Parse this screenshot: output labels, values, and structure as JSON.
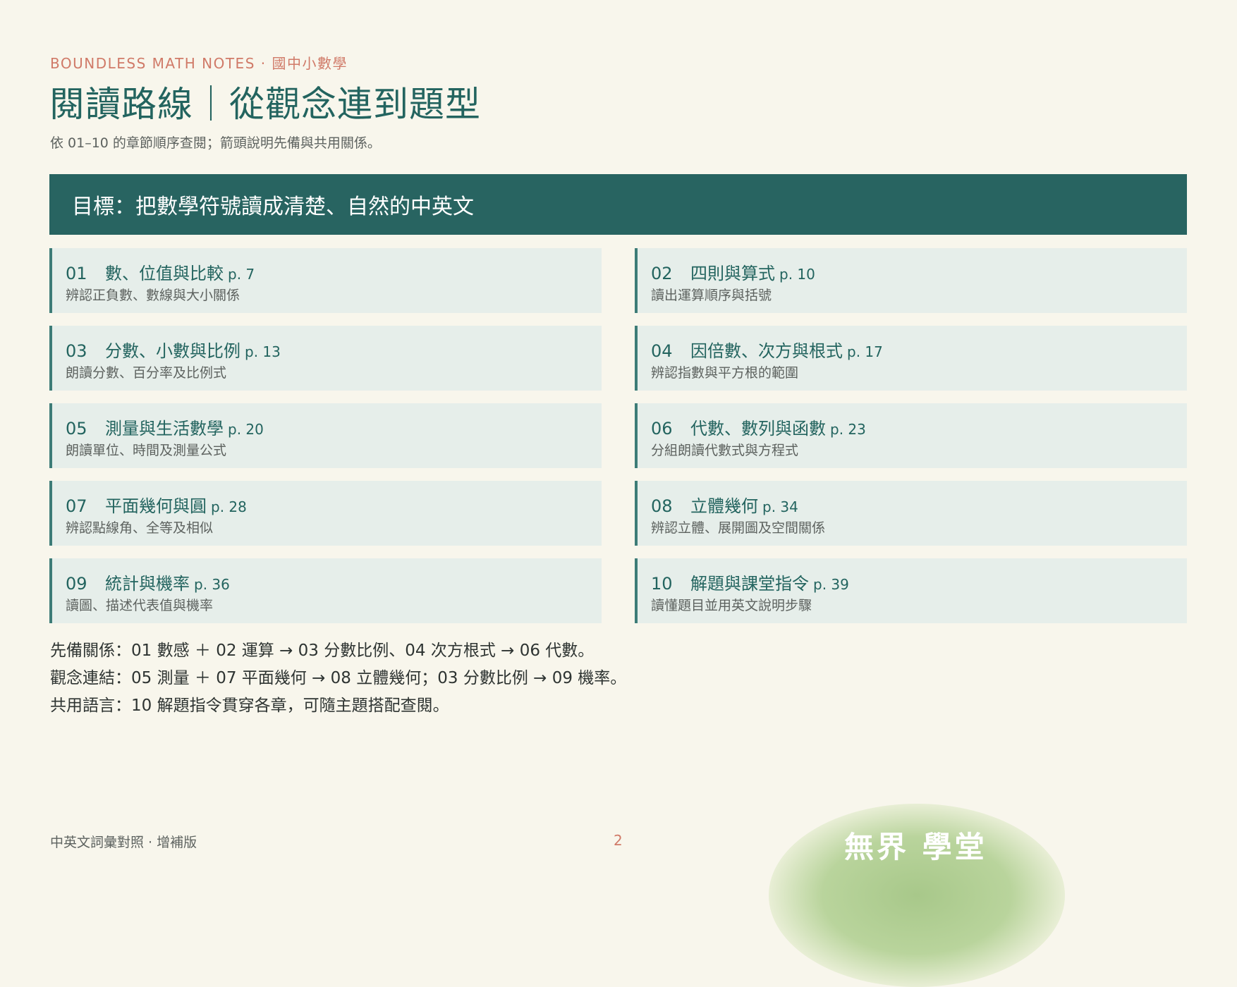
{
  "header": {
    "eyebrow": "BOUNDLESS MATH NOTES · 國中小數學",
    "title": "閱讀路線｜從觀念連到題型",
    "subtitle": "依 01–10 的章節順序查閱；箭頭說明先備與共用關係。"
  },
  "goal": "目標：把數學符號讀成清楚、自然的中英文",
  "chapters": [
    {
      "num": "01",
      "title": "數、位值與比較",
      "page": "p. 7",
      "desc": "辨認正負數、數線與大小關係"
    },
    {
      "num": "02",
      "title": "四則與算式",
      "page": "p. 10",
      "desc": "讀出運算順序與括號"
    },
    {
      "num": "03",
      "title": "分數、小數與比例",
      "page": "p. 13",
      "desc": "朗讀分數、百分率及比例式"
    },
    {
      "num": "04",
      "title": "因倍數、次方與根式",
      "page": "p. 17",
      "desc": "辨認指數與平方根的範圍"
    },
    {
      "num": "05",
      "title": "測量與生活數學",
      "page": "p. 20",
      "desc": "朗讀單位、時間及測量公式"
    },
    {
      "num": "06",
      "title": "代數、數列與函數",
      "page": "p. 23",
      "desc": "分組朗讀代數式與方程式"
    },
    {
      "num": "07",
      "title": "平面幾何與圓",
      "page": "p. 28",
      "desc": "辨認點線角、全等及相似"
    },
    {
      "num": "08",
      "title": "立體幾何",
      "page": "p. 34",
      "desc": "辨認立體、展開圖及空間關係"
    },
    {
      "num": "09",
      "title": "統計與機率",
      "page": "p. 36",
      "desc": "讀圖、描述代表值與機率"
    },
    {
      "num": "10",
      "title": "解題與課堂指令",
      "page": "p. 39",
      "desc": "讀懂題目並用英文說明步驟"
    }
  ],
  "notes": [
    "先備關係：01 數感 ＋ 02 運算 → 03 分數比例、04 次方根式 → 06 代數。",
    "觀念連結：05 測量 ＋ 07 平面幾何 → 08 立體幾何；03 分數比例 → 09 機率。",
    "共用語言：10 解題指令貫穿各章，可隨主題搭配查閱。"
  ],
  "footer": {
    "left": "中英文詞彙對照 · 增補版",
    "page_number": "2",
    "brand": "無界 學堂"
  }
}
